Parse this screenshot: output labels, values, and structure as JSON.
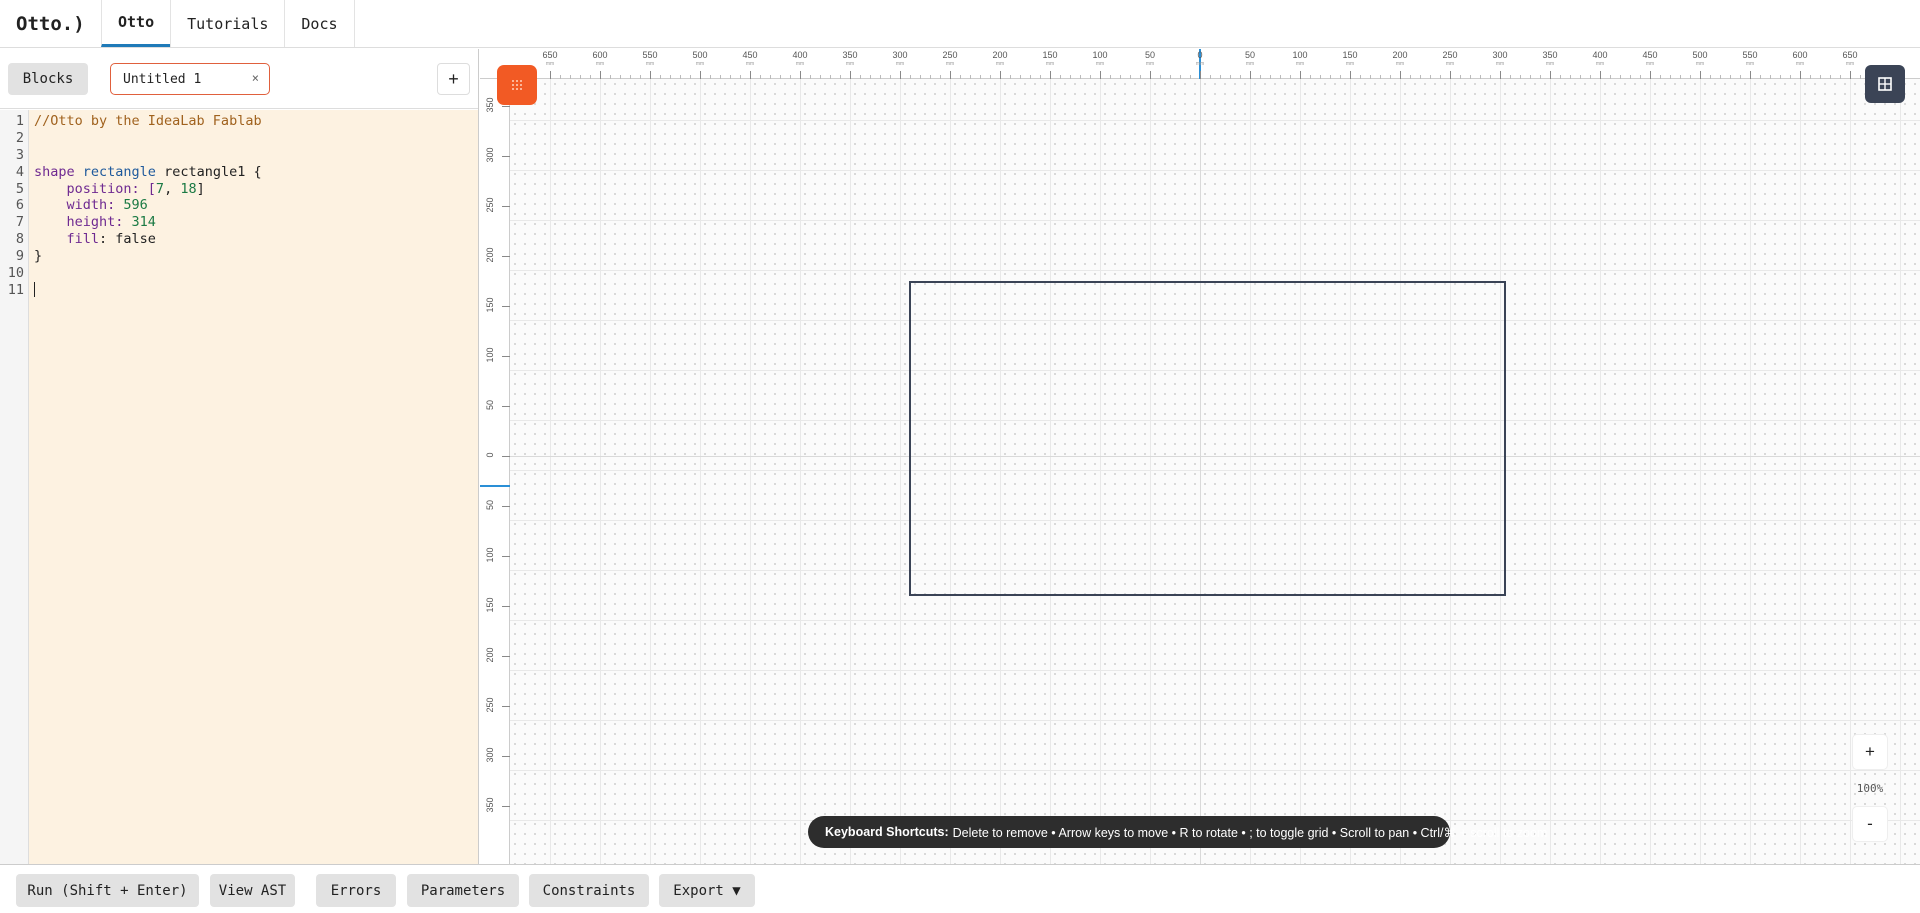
{
  "app": {
    "brand": "Otto.)",
    "nav_tabs": [
      "Otto",
      "Tutorials",
      "Docs"
    ]
  },
  "left_toolbar": {
    "blocks_label": "Blocks",
    "file_tab": "Untitled 1",
    "close_symbol": "×",
    "add_label": "+"
  },
  "editor": {
    "line_numbers": [
      "1",
      "2",
      "3",
      "4",
      "5",
      "6",
      "7",
      "8",
      "9",
      "10",
      "11"
    ],
    "code": {
      "comment": "//Otto by the IdeaLab Fablab",
      "kw_shape": "shape",
      "type_rect": "rectangle",
      "name": "rectangle1 {",
      "position_key": "    position: [",
      "position_x": "7",
      "position_sep": ", ",
      "position_y": "18",
      "position_end": "]",
      "width_key": "    width: ",
      "width_val": "596",
      "height_key": "    height: ",
      "height_val": "314",
      "fill_key": "    fill",
      "fill_val": ": false",
      "close_brace": "}"
    }
  },
  "canvas": {
    "ruler_unit": "mm",
    "ruler_top_labels": [
      "650",
      "600",
      "550",
      "500",
      "450",
      "400",
      "350",
      "300",
      "250",
      "200",
      "150",
      "100",
      "50",
      "0",
      "50",
      "100",
      "150",
      "200",
      "250",
      "300",
      "350",
      "400",
      "450",
      "500",
      "550",
      "600",
      "650"
    ],
    "ruler_left_labels": [
      "350",
      "300",
      "250",
      "200",
      "150",
      "100",
      "50",
      "0",
      "50",
      "100",
      "150",
      "200",
      "250",
      "300",
      "350"
    ],
    "zoom_in": "+",
    "zoom_level": "100%",
    "zoom_out": "-",
    "shortcuts_title": "Keyboard Shortcuts:",
    "shortcuts_text": "Delete to remove • Arrow keys to move • R to rotate • ; to toggle grid • Scroll to pan • Ctrl/⌘ + scroll to zoom",
    "handle_icon": "drag-grid-icon",
    "grid_icon": "grid-icon",
    "accent": "#f25a24"
  },
  "bottom": {
    "run": "Run (Shift + Enter)",
    "view_ast": "View AST",
    "errors": "Errors",
    "parameters": "Parameters",
    "constraints": "Constraints",
    "export": "Export ▼"
  }
}
